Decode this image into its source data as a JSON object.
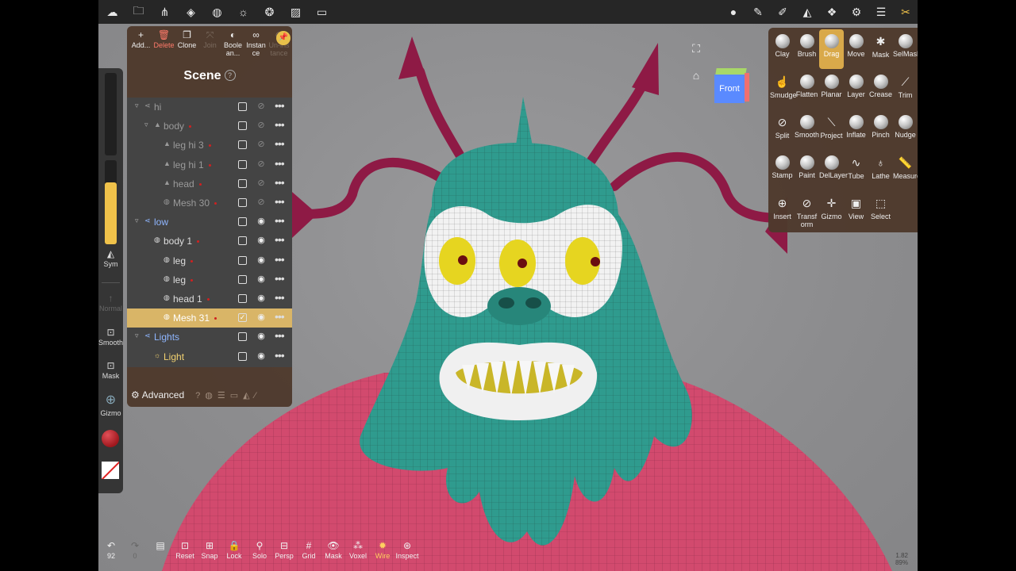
{
  "topbar": {
    "left_icons": [
      "nomad-logo-icon",
      "folder-icon",
      "scene-graph-icon",
      "layers-shape-icon",
      "material-sphere-icon",
      "light-sun-icon",
      "color-wheel-icon",
      "image-icon",
      "video-icon"
    ],
    "right_icons": [
      "material-ball-icon",
      "paint-brush-icon",
      "pen-icon",
      "triangle-icon",
      "stack-icon",
      "gear-icon",
      "sliders-icon",
      "tools-icon"
    ]
  },
  "left_toolbar": {
    "sym_label": "Sym",
    "normal_label": "Normal",
    "smooth_label": "Smooth",
    "mask_label": "Mask",
    "gizmo_label": "Gizmo",
    "brush_color": "#c0262e"
  },
  "scene_panel": {
    "title": "Scene",
    "help": "?",
    "actions": [
      {
        "label": "Add...",
        "icon": "+"
      },
      {
        "label": "Delete",
        "icon": "🗑"
      },
      {
        "label": "Clone",
        "icon": "❐"
      },
      {
        "label": "Join",
        "icon": "⤧"
      },
      {
        "label": "Boole an...",
        "icon": "◐"
      },
      {
        "label": "Instan ce",
        "icon": "∞"
      },
      {
        "label": "Un-ins tance",
        "icon": "⊘"
      }
    ],
    "tree": [
      {
        "label": "hi",
        "indent": 0,
        "arrow": "▿",
        "icon": "⋖",
        "style": "dim",
        "eye": false,
        "checked": false,
        "dot": false
      },
      {
        "label": "body",
        "indent": 1,
        "arrow": "▿",
        "icon": "▲",
        "style": "dim",
        "eye": false,
        "checked": false,
        "dot": true
      },
      {
        "label": "leg hi 3",
        "indent": 2,
        "arrow": "",
        "icon": "▲",
        "style": "dim",
        "eye": false,
        "checked": false,
        "dot": true
      },
      {
        "label": "leg hi 1",
        "indent": 2,
        "arrow": "",
        "icon": "▲",
        "style": "dim",
        "eye": false,
        "checked": false,
        "dot": true
      },
      {
        "label": "head",
        "indent": 2,
        "arrow": "",
        "icon": "▲",
        "style": "dim",
        "eye": false,
        "checked": false,
        "dot": true
      },
      {
        "label": "Mesh 30",
        "indent": 2,
        "arrow": "",
        "icon": "◍",
        "style": "dim",
        "eye": false,
        "checked": false,
        "dot": true
      },
      {
        "label": "low",
        "indent": 0,
        "arrow": "▿",
        "icon": "⋖",
        "style": "blue",
        "eye": true,
        "checked": false,
        "dot": false
      },
      {
        "label": "body 1",
        "indent": 1,
        "arrow": "",
        "icon": "◍",
        "style": "normal",
        "eye": true,
        "checked": false,
        "dot": true
      },
      {
        "label": "leg",
        "indent": 2,
        "arrow": "",
        "icon": "◍",
        "style": "normal",
        "eye": true,
        "checked": false,
        "dot": true
      },
      {
        "label": "leg",
        "indent": 2,
        "arrow": "",
        "icon": "◍",
        "style": "normal",
        "eye": true,
        "checked": false,
        "dot": true
      },
      {
        "label": "head 1",
        "indent": 2,
        "arrow": "",
        "icon": "◍",
        "style": "normal",
        "eye": true,
        "checked": false,
        "dot": true
      },
      {
        "label": "Mesh 31",
        "indent": 2,
        "arrow": "",
        "icon": "◍",
        "style": "sel",
        "eye": true,
        "checked": true,
        "dot": true
      },
      {
        "label": "Lights",
        "indent": 0,
        "arrow": "▿",
        "icon": "⋖",
        "style": "blue",
        "eye": true,
        "checked": false,
        "dot": false
      },
      {
        "label": "Light",
        "indent": 1,
        "arrow": "",
        "icon": "☼",
        "style": "yellow",
        "eye": true,
        "checked": false,
        "dot": false
      }
    ],
    "advanced_label": "Advanced"
  },
  "viewcube": {
    "face_label": "Front"
  },
  "tools": [
    {
      "label": "Clay",
      "kind": "ball"
    },
    {
      "label": "Brush",
      "kind": "ball"
    },
    {
      "label": "Drag",
      "kind": "ball",
      "active": true
    },
    {
      "label": "Move",
      "kind": "ball"
    },
    {
      "label": "Mask",
      "kind": "glyph",
      "glyph": "✱"
    },
    {
      "label": "SelMask",
      "kind": "ball"
    },
    {
      "label": "Smudge",
      "kind": "glyph",
      "glyph": "☝"
    },
    {
      "label": "Flatten",
      "kind": "ball"
    },
    {
      "label": "Planar",
      "kind": "ball"
    },
    {
      "label": "Layer",
      "kind": "ball"
    },
    {
      "label": "Crease",
      "kind": "ball"
    },
    {
      "label": "Trim",
      "kind": "glyph",
      "glyph": "⟋"
    },
    {
      "label": "Split",
      "kind": "glyph",
      "glyph": "⊘"
    },
    {
      "label": "Smooth",
      "kind": "ball"
    },
    {
      "label": "Project",
      "kind": "glyph",
      "glyph": "⟍"
    },
    {
      "label": "Inflate",
      "kind": "ball"
    },
    {
      "label": "Pinch",
      "kind": "ball"
    },
    {
      "label": "Nudge",
      "kind": "ball"
    },
    {
      "label": "Stamp",
      "kind": "ball"
    },
    {
      "label": "Paint",
      "kind": "ball"
    },
    {
      "label": "DelLayer",
      "kind": "ball"
    },
    {
      "label": "Tube",
      "kind": "glyph",
      "glyph": "∿"
    },
    {
      "label": "Lathe",
      "kind": "glyph",
      "glyph": "♁"
    },
    {
      "label": "Measure",
      "kind": "glyph",
      "glyph": "📏"
    },
    {
      "label": "Insert",
      "kind": "glyph",
      "glyph": "⊕"
    },
    {
      "label": "Transf orm",
      "kind": "glyph",
      "glyph": "⊘"
    },
    {
      "label": "Gizmo",
      "kind": "glyph",
      "glyph": "✛"
    },
    {
      "label": "View",
      "kind": "glyph",
      "glyph": "▣"
    },
    {
      "label": "Select",
      "kind": "glyph",
      "glyph": "⬚"
    }
  ],
  "bottombar": {
    "undo_count": "92",
    "redo_count": "0",
    "buttons": [
      {
        "label": "Reset",
        "icon": "⊡"
      },
      {
        "label": "Snap",
        "icon": "⊞"
      },
      {
        "label": "Lock",
        "icon": "🔒"
      },
      {
        "label": "Solo",
        "icon": "⚲"
      },
      {
        "label": "Persp",
        "icon": "⊟"
      },
      {
        "label": "Grid",
        "icon": "#"
      },
      {
        "label": "Mask",
        "icon": "👁"
      },
      {
        "label": "Voxel",
        "icon": "⁂"
      },
      {
        "label": "Wire",
        "icon": "✹"
      },
      {
        "label": "Inspect",
        "icon": "⊛"
      }
    ],
    "stats_line1": "1.82",
    "stats_line2": "89%"
  }
}
